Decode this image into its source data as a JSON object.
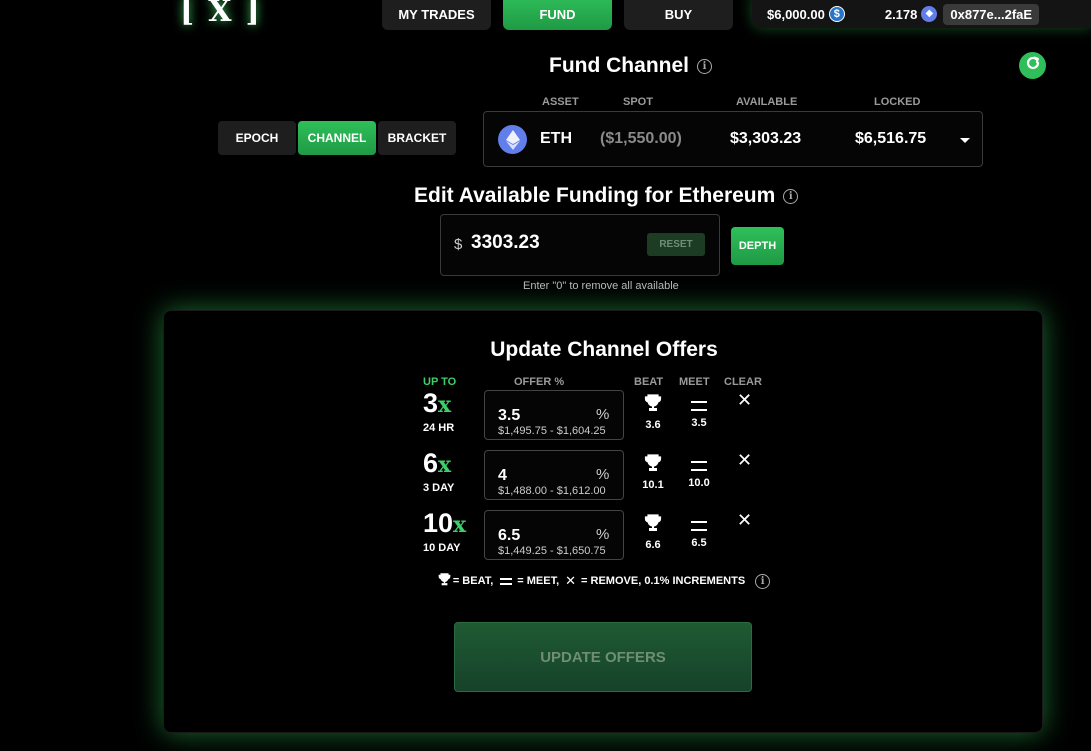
{
  "logo": {
    "left_bracket": "[",
    "mark": "X",
    "right_bracket": "]"
  },
  "nav": {
    "my_trades": "MY TRADES",
    "fund": "FUND",
    "buy": "BUY"
  },
  "wallet": {
    "usd_balance": "$6,000.00",
    "usd_icon": "$",
    "eth_balance": "2.178",
    "eth_icon": "◆",
    "address": "0x877e...2faE"
  },
  "fund_channel": {
    "title": "Fund Channel",
    "info": "i"
  },
  "tabs": {
    "epoch": "EPOCH",
    "channel": "CHANNEL",
    "bracket": "BRACKET"
  },
  "asset_table": {
    "headers": {
      "asset": "ASSET",
      "spot": "SPOT",
      "available": "AVAILABLE",
      "locked": "LOCKED"
    },
    "row": {
      "asset": "ETH",
      "spot": "($1,550.00)",
      "available": "$3,303.23",
      "locked": "$6,516.75"
    }
  },
  "edit_funding": {
    "title": "Edit Available Funding for Ethereum",
    "info": "i",
    "currency": "$",
    "value": "3303.23",
    "reset_label": "RESET",
    "depth_label": "DEPTH",
    "hint": "Enter \"0\" to remove all available"
  },
  "offers": {
    "title": "Update Channel Offers",
    "headers": {
      "up_to": "UP TO",
      "offer_pct": "OFFER %",
      "beat": "BEAT",
      "meet": "MEET",
      "clear": "CLEAR"
    },
    "rows": [
      {
        "mult": "3",
        "x": "x",
        "duration": "24 HR",
        "pct": "3.5",
        "pct_sym": "%",
        "range": "$1,495.75 - $1,604.25",
        "beat": "3.6",
        "meet": "3.5",
        "clear": "✕"
      },
      {
        "mult": "6",
        "x": "x",
        "duration": "3 DAY",
        "pct": "4",
        "pct_sym": "%",
        "range": "$1,488.00 - $1,612.00",
        "beat": "10.1",
        "meet": "10.0",
        "clear": "✕"
      },
      {
        "mult": "10",
        "x": "x",
        "duration": "10 DAY",
        "pct": "6.5",
        "pct_sym": "%",
        "range": "$1,449.25 - $1,650.75",
        "beat": "6.6",
        "meet": "6.5",
        "clear": "✕"
      }
    ],
    "legend": {
      "beat_text": "= BEAT,",
      "meet_text": "= MEET,",
      "remove_icon": "✕",
      "remove_text": "= REMOVE, 0.1% INCREMENTS",
      "info": "i"
    },
    "update_label": "UPDATE OFFERS"
  },
  "colors": {
    "accent_green": "#2fbf5a",
    "eth_blue": "#627eea",
    "usdc_blue": "#2775ca"
  }
}
